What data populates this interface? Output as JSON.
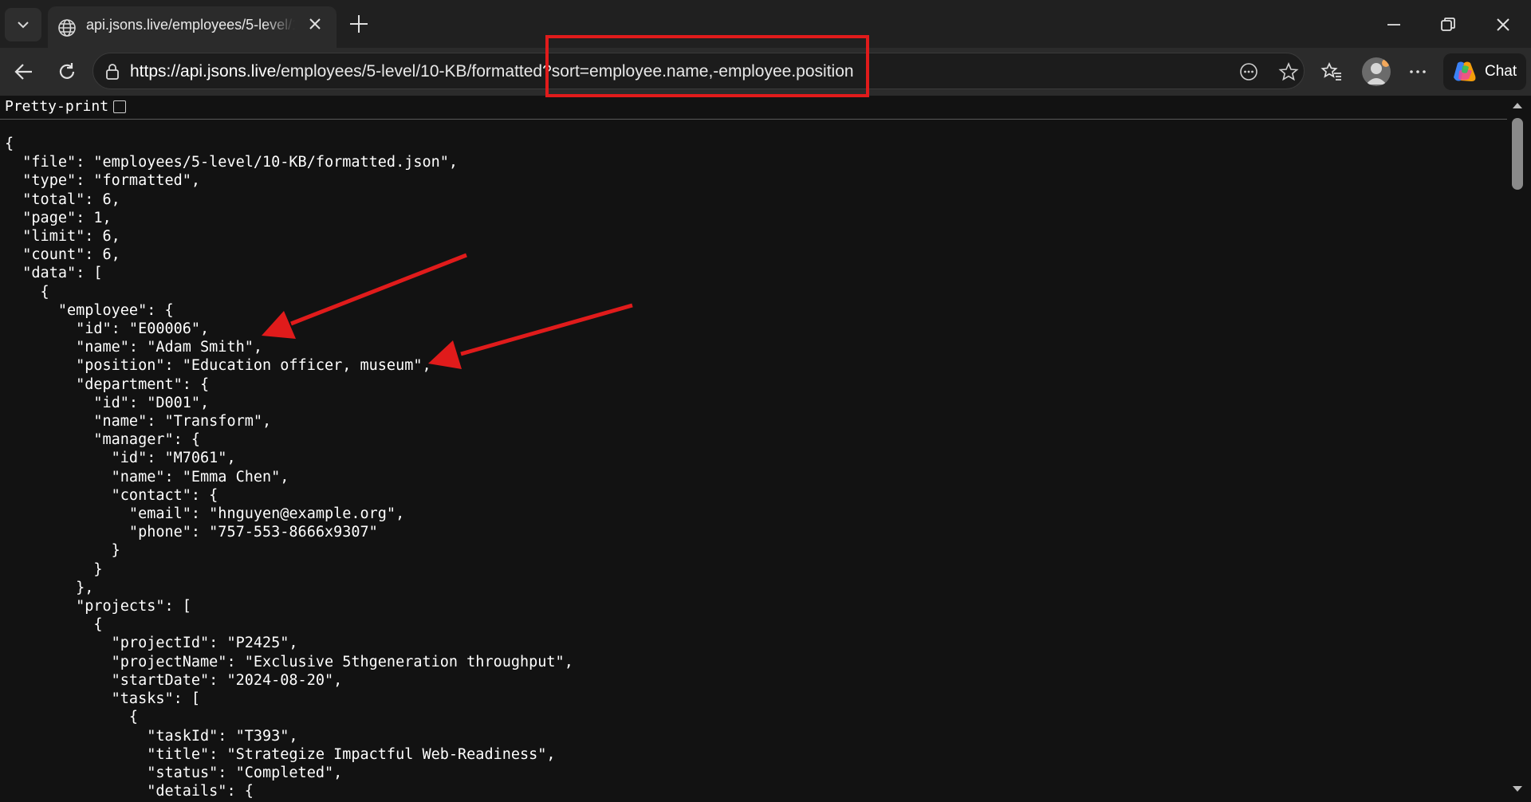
{
  "tab": {
    "title": "api.jsons.live/employees/5-level/10-KB/formatted.json?sort=employee.name,-employee.position",
    "favicon": "globe-icon"
  },
  "address": {
    "url_host": "https://api.jsons.live",
    "url_path": "/employees/5-level/10-KB/formatted",
    "url_query": "?sort=employee.name,-employee.position"
  },
  "toolbar": {
    "chat_label": "Chat"
  },
  "viewer": {
    "pretty_print_label": "Pretty-print",
    "pretty_print_checked": false,
    "json_text": "{\n  \"file\": \"employees/5-level/10-KB/formatted.json\",\n  \"type\": \"formatted\",\n  \"total\": 6,\n  \"page\": 1,\n  \"limit\": 6,\n  \"count\": 6,\n  \"data\": [\n    {\n      \"employee\": {\n        \"id\": \"E00006\",\n        \"name\": \"Adam Smith\",\n        \"position\": \"Education officer, museum\",\n        \"department\": {\n          \"id\": \"D001\",\n          \"name\": \"Transform\",\n          \"manager\": {\n            \"id\": \"M7061\",\n            \"name\": \"Emma Chen\",\n            \"contact\": {\n              \"email\": \"hnguyen@example.org\",\n              \"phone\": \"757-553-8666x9307\"\n            }\n          }\n        },\n        \"projects\": [\n          {\n            \"projectId\": \"P2425\",\n            \"projectName\": \"Exclusive 5thgeneration throughput\",\n            \"startDate\": \"2024-08-20\",\n            \"tasks\": [\n              {\n                \"taskId\": \"T393\",\n                \"title\": \"Strategize Impactful Web-Readiness\",\n                \"status\": \"Completed\",\n                \"details\": {"
  },
  "colors": {
    "annotation_red": "#e01b1b",
    "page_background": "#121212",
    "toolbar_background": "#2b2b2b"
  }
}
